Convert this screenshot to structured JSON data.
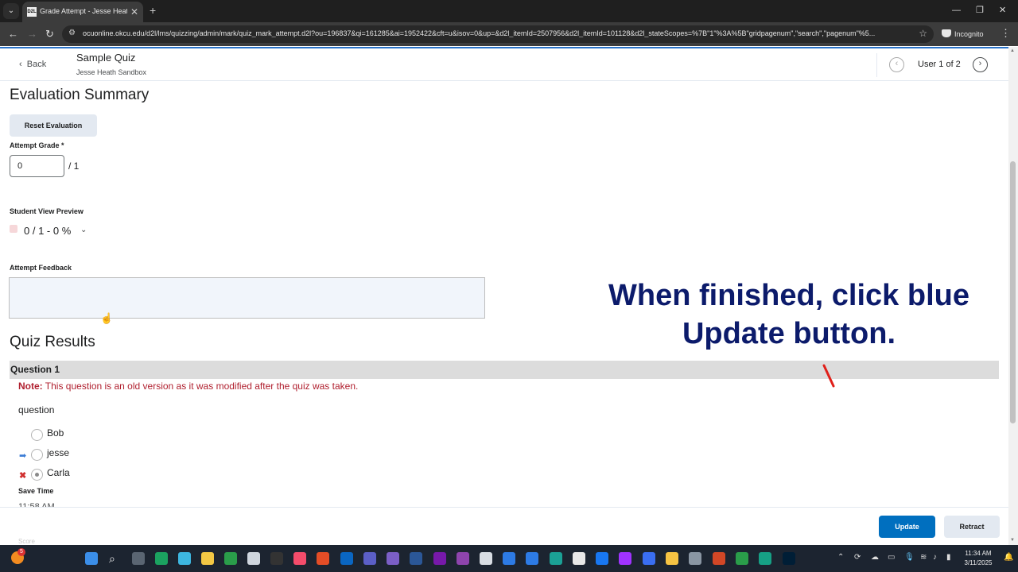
{
  "browser": {
    "tab_title": "Grade Attempt - Jesse Heath Sa",
    "tab_favicon_text": "D2L",
    "url": "ocuonline.okcu.edu/d2l/lms/quizzing/admin/mark/quiz_mark_attempt.d2l?ou=196837&qi=161285&ai=1952422&cft=u&isov=0&up=&d2l_itemId=2507956&d2l_itemId=101128&d2l_stateScopes=%7B\"1\"%3A%5B\"gridpagenum\",\"search\",\"pagenum\"%5...",
    "incognito_label": "Incognito"
  },
  "header": {
    "back_label": "Back",
    "quiz_title": "Sample Quiz",
    "course_name": "Jesse Heath Sandbox",
    "user_count": "User 1 of 2"
  },
  "evaluation": {
    "heading": "Evaluation Summary",
    "reset_label": "Reset Evaluation",
    "attempt_grade_label": "Attempt Grade *",
    "grade_value": "0",
    "grade_out_of": "/ 1",
    "student_view_label": "Student View Preview",
    "student_view_score": "0 / 1 - 0 %",
    "feedback_label": "Attempt Feedback"
  },
  "quiz_results": {
    "heading": "Quiz Results",
    "question_header": "Question 1",
    "note_prefix": "Note:",
    "note_text": "This question is an old version as it was modified after the quiz was taken.",
    "question_text": "question",
    "options": [
      {
        "label": "Bob",
        "mark": "",
        "selected": false
      },
      {
        "label": "jesse",
        "mark": "arrow-right-icon",
        "selected": false
      },
      {
        "label": "Carla",
        "mark": "x-incorrect-icon",
        "selected": true
      }
    ],
    "save_time_label": "Save Time",
    "save_time_value": "11:58 AM"
  },
  "footer": {
    "update_label": "Update",
    "retract_label": "Retract",
    "faint_text": "Score"
  },
  "annotation": {
    "text": "When finished, click blue Update button."
  },
  "taskbar": {
    "time": "11:34 AM",
    "date": "3/11/2025",
    "notification_count": "5"
  }
}
